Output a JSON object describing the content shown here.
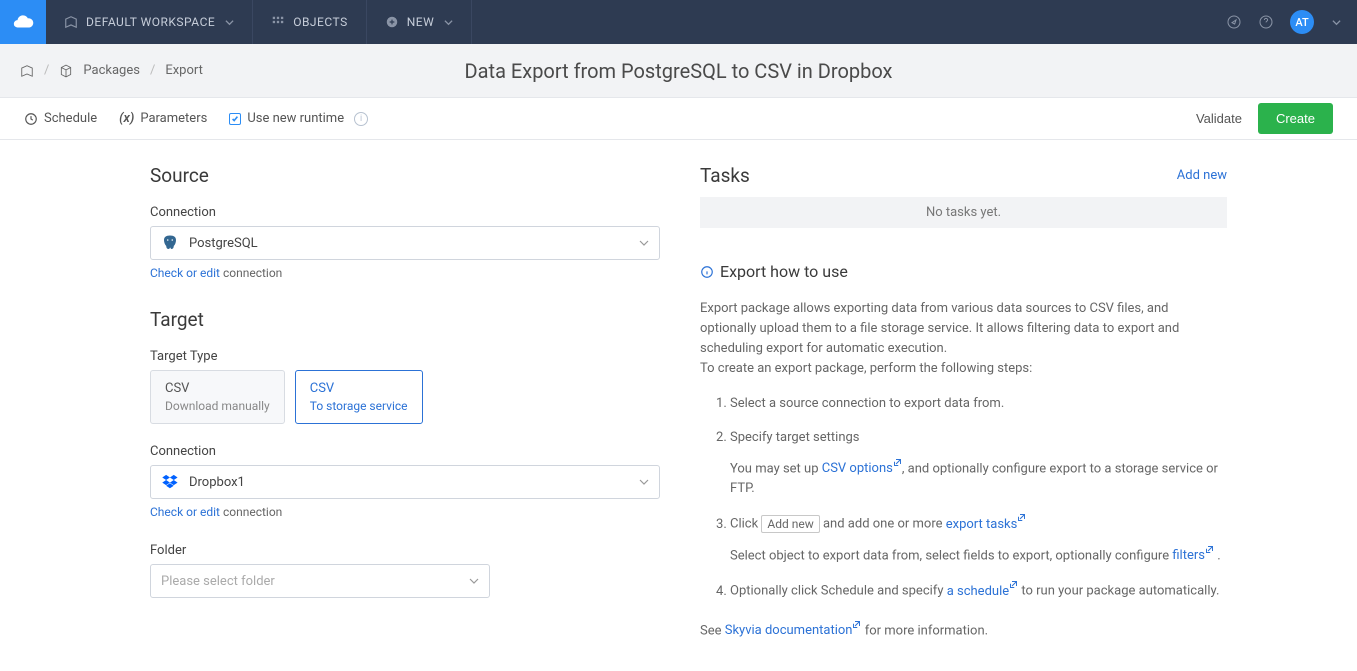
{
  "topnav": {
    "workspace": "DEFAULT WORKSPACE",
    "objects": "OBJECTS",
    "new": "NEW",
    "avatar": "AT"
  },
  "breadcrumb": {
    "packages": "Packages",
    "current": "Export"
  },
  "page_title": "Data Export from PostgreSQL to CSV in Dropbox",
  "toolbar": {
    "schedule": "Schedule",
    "parameters": "Parameters",
    "use_new_runtime": "Use new runtime",
    "validate": "Validate",
    "create": "Create"
  },
  "source": {
    "heading": "Source",
    "connection_label": "Connection",
    "connection_value": "PostgreSQL",
    "check_edit_prefix": "Check or edit",
    "check_edit_suffix": " connection"
  },
  "target": {
    "heading": "Target",
    "type_label": "Target Type",
    "csv1_title": "CSV",
    "csv1_sub": "Download manually",
    "csv2_title": "CSV",
    "csv2_sub": "To storage service",
    "connection_label": "Connection",
    "connection_value": "Dropbox1",
    "check_edit_prefix": "Check or edit",
    "check_edit_suffix": " connection",
    "folder_label": "Folder",
    "folder_placeholder": "Please select folder"
  },
  "tasks": {
    "heading": "Tasks",
    "add_new": "Add new",
    "empty": "No tasks yet."
  },
  "howto": {
    "title": "Export how to use",
    "intro1": "Export package allows exporting data from various data sources to CSV files, and optionally upload them to a file storage service. It allows filtering data to export and scheduling export for automatic execution.",
    "intro2": "To create an export package, perform the following steps:",
    "step1": "Select a source connection to export data from.",
    "step2": "Specify target settings",
    "step2_sub_a": "You may set up ",
    "step2_link": "CSV options",
    "step2_sub_b": ", and optionally configure export to a storage service or FTP.",
    "step3_a": "Click ",
    "step3_btn": "Add new",
    "step3_b": " and add one or more ",
    "step3_link": "export tasks",
    "step3_sub_a": "Select object to export data from, select fields to export, optionally configure ",
    "step3_sub_link": "filters",
    "step3_sub_b": " .",
    "step4_a": "Optionally click Schedule and specify ",
    "step4_link": "a schedule",
    "step4_b": " to run your package automatically.",
    "footer_a": "See ",
    "footer_link": "Skyvia documentation",
    "footer_b": " for more information."
  }
}
